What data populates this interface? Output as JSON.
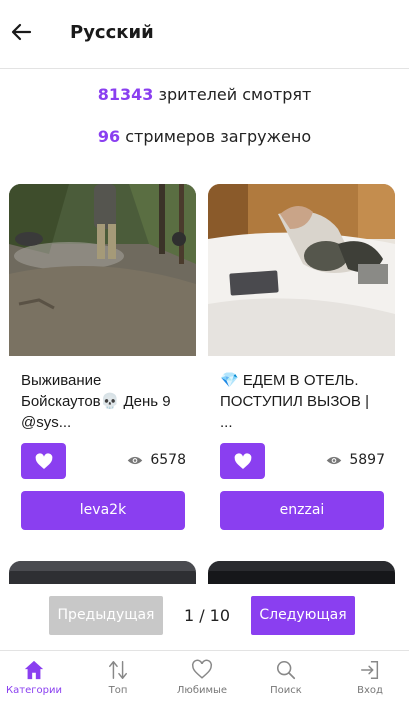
{
  "header": {
    "title": "Русский"
  },
  "stats": {
    "viewers_count": "81343",
    "viewers_text": " зрителей смотрят",
    "streamers_count": "96",
    "streamers_text": " стримеров загружено"
  },
  "streams": [
    {
      "title": "Выживание Бойскаутов💀 День 9 @sys...",
      "viewers": "6578",
      "name": "leva2k"
    },
    {
      "title": "💎 ЕДЕМ В ОТЕЛЬ. ПОСТУПИЛ ВЫЗОВ | ...",
      "viewers": "5897",
      "name": "enzzai"
    }
  ],
  "pagination": {
    "prev_label": "Предыдущая",
    "page": "1 / 10",
    "next_label": "Следующая"
  },
  "nav": {
    "categories": "Категории",
    "top": "Топ",
    "favorites": "Любимые",
    "search": "Поиск",
    "login": "Вход"
  },
  "colors": {
    "accent": "#8a3ff0",
    "disabled": "#c8c8c8"
  }
}
